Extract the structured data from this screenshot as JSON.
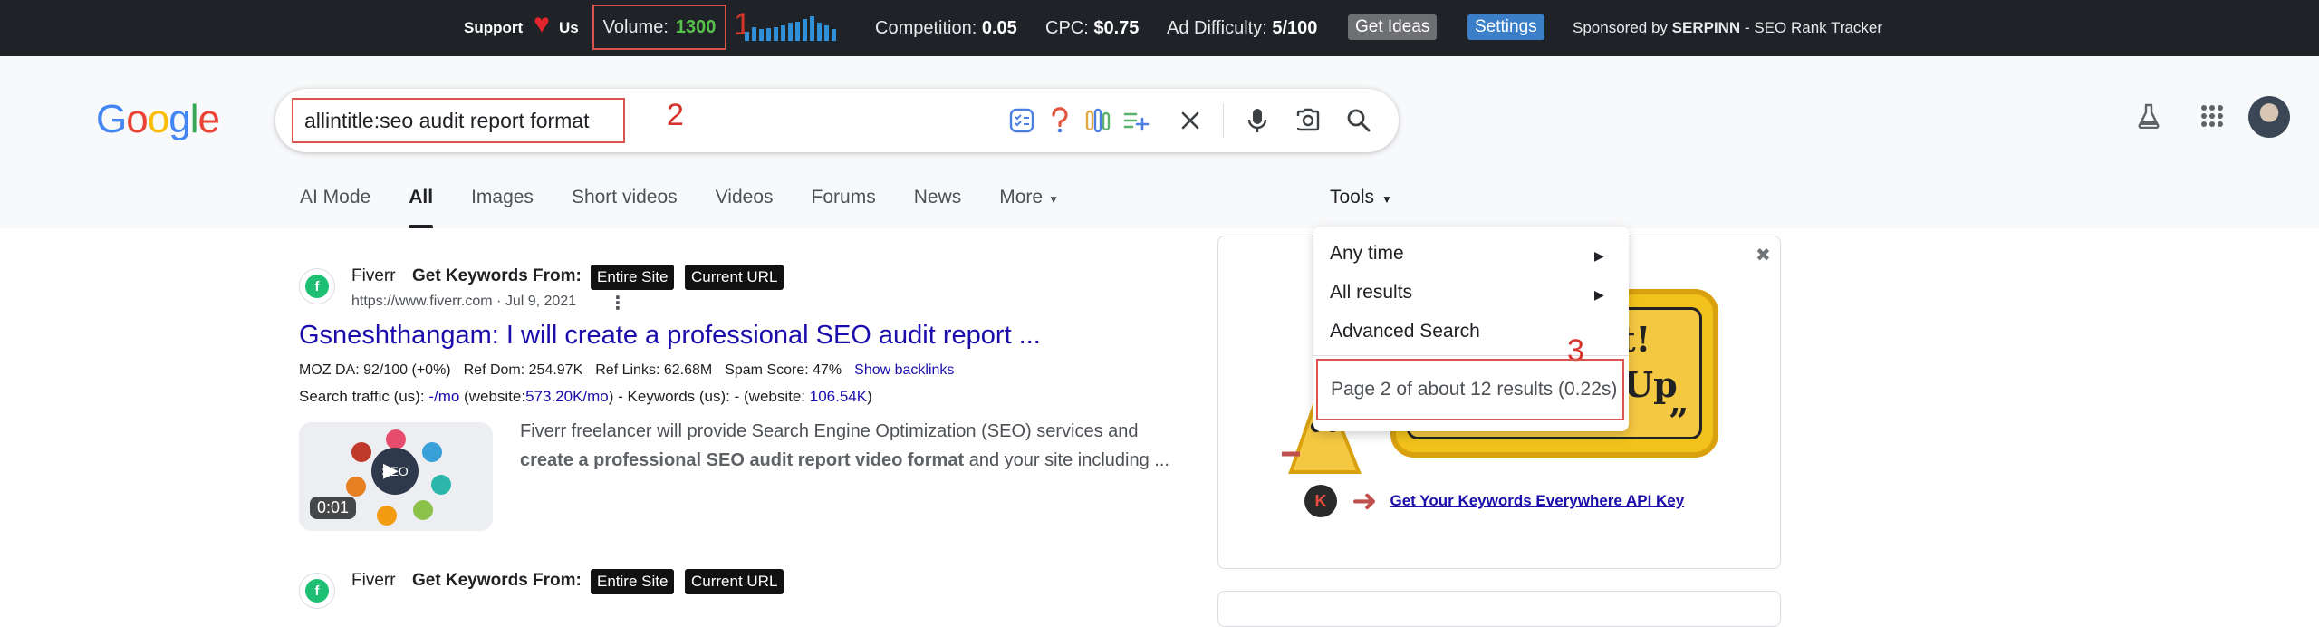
{
  "seo_bar": {
    "support_label_1": "Support",
    "support_label_2": "Us",
    "heart": "♥",
    "volume_label": "Volume:",
    "volume_value": "1300",
    "annotation_1": "1",
    "trend_values": [
      0.35,
      0.55,
      0.45,
      0.5,
      0.55,
      0.6,
      0.7,
      0.75,
      0.85,
      0.95,
      0.7,
      0.6,
      0.45
    ],
    "competition_label": "Competition:",
    "competition_value": "0.05",
    "cpc_label": "CPC:",
    "cpc_value": "$0.75",
    "ad_difficulty_label": "Ad Difficulty:",
    "ad_difficulty_value": "5/100",
    "get_ideas_label": "Get Ideas",
    "settings_label": "Settings",
    "sponsored_prefix": "Sponsored by",
    "sponsored_brand": "SERPINN",
    "sponsored_suffix": "- SEO Rank Tracker"
  },
  "header": {
    "logo_letters": [
      "G",
      "o",
      "o",
      "g",
      "l",
      "e"
    ],
    "query": "allintitle:seo audit report format",
    "annotation_2": "2",
    "tabs": [
      {
        "label": "AI Mode"
      },
      {
        "label": "All"
      },
      {
        "label": "Images"
      },
      {
        "label": "Short videos"
      },
      {
        "label": "Videos"
      },
      {
        "label": "Forums"
      },
      {
        "label": "News"
      },
      {
        "label": "More"
      }
    ],
    "tools_label": "Tools"
  },
  "result_1": {
    "site_name": "Fiverr",
    "kw_from_label": "Get Keywords From:",
    "entire_site_label": "Entire Site",
    "current_url_label": "Current URL",
    "url": "https://www.fiverr.com · Jul 9, 2021",
    "title": "Gsneshthangam: I will create a professional SEO audit report ...",
    "moz_da": "MOZ DA: 92/100 (+0%)",
    "ref_dom": "Ref Dom: 254.97K",
    "ref_links": "Ref Links: 62.68M",
    "spam_score": "Spam Score: 47%",
    "show_backlinks": "Show backlinks",
    "traffic_prefix": "Search traffic (us):",
    "traffic_value": "-/mo",
    "traffic_website_prefix": "(website:",
    "traffic_website_value": "573.20K/mo",
    "keywords_prefix": ") - Keywords (us): - (website:",
    "keywords_website_value": "106.54K",
    "keywords_suffix": ")",
    "thumb_label": "SEO",
    "duration": "0:01",
    "snippet_1": "Fiverr freelancer will provide Search Engine Optimization (SEO) services and",
    "snippet_bold": "create a professional SEO audit report video format",
    "snippet_2": "and your site including ..."
  },
  "result_2": {
    "site_name": "Fiverr",
    "kw_from_label": "Get Keywords From:",
    "entire_site_label": "Entire Site",
    "current_url_label": "Current URL"
  },
  "panel": {
    "close": "✖",
    "promo_line_1": "t!",
    "promo_line_2": "Up",
    "promo_quote": "”",
    "k_logo": "K",
    "api_link": "Get Your Keywords Everywhere API Key"
  },
  "tools_dropdown": {
    "items": [
      {
        "label": "Any time"
      },
      {
        "label": "All results"
      },
      {
        "label": "Advanced Search"
      }
    ],
    "result_stats": "Page 2 of about 12 results (0.22s)",
    "annotation_3": "3"
  },
  "colors": {
    "annotation_red": "#d9342b",
    "volume_green": "#58c24c",
    "trend_blue": "#2f8fd7",
    "link_blue": "#1a0dab"
  }
}
